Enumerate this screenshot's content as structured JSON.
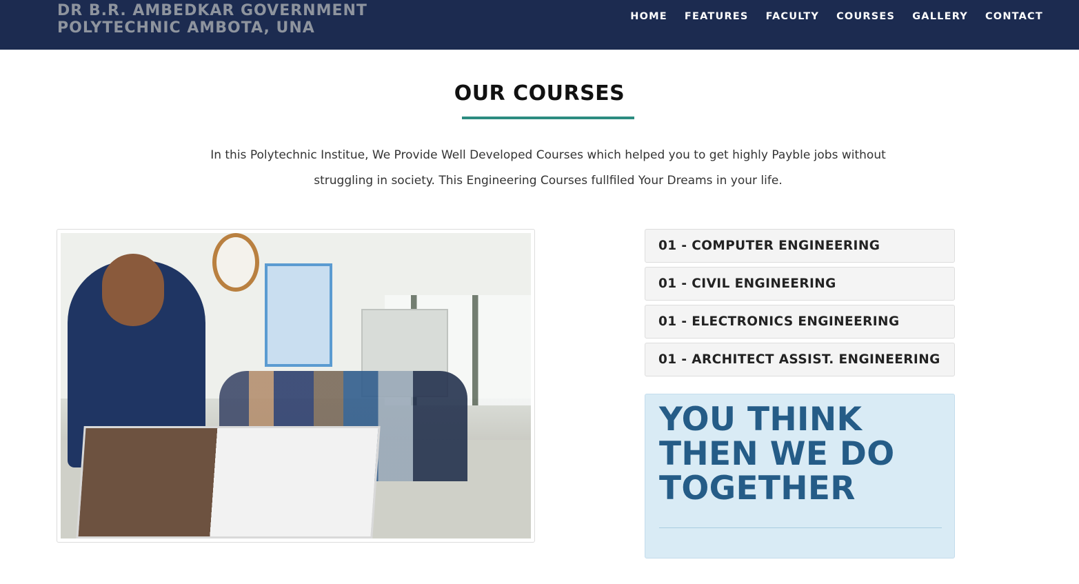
{
  "header": {
    "brand_line1": "DR B.R. AMBEDKAR GOVERNMENT",
    "brand_line2": "POLYTECHNIC AMBOTA, UNA",
    "nav": [
      "HOME",
      "FEATURES",
      "FACULTY",
      "COURSES",
      "GALLERY",
      "CONTACT"
    ]
  },
  "section": {
    "title": "OUR COURSES",
    "intro_line1": "In this Polytechnic Institue, We Provide Well Developed Courses which helped you to get highly Payble jobs without",
    "intro_line2": "struggling in society. This Engineering Courses fullfiled Your Dreams in your life."
  },
  "courses": [
    "01 - COMPUTER ENGINEERING",
    "01 - CIVIL ENGINEERING",
    "01 - ELECTRONICS ENGINEERING",
    "01 - ARCHITECT ASSIST. ENGINEERING"
  ],
  "callout": {
    "line1": "YOU THINK",
    "line2": "THEN WE DO",
    "line3": "TOGETHER"
  },
  "colors": {
    "navbar": "#1c2b50",
    "accent_underline": "#2c8c80",
    "callout_bg": "#d9ebf5",
    "callout_text": "#255c87"
  }
}
